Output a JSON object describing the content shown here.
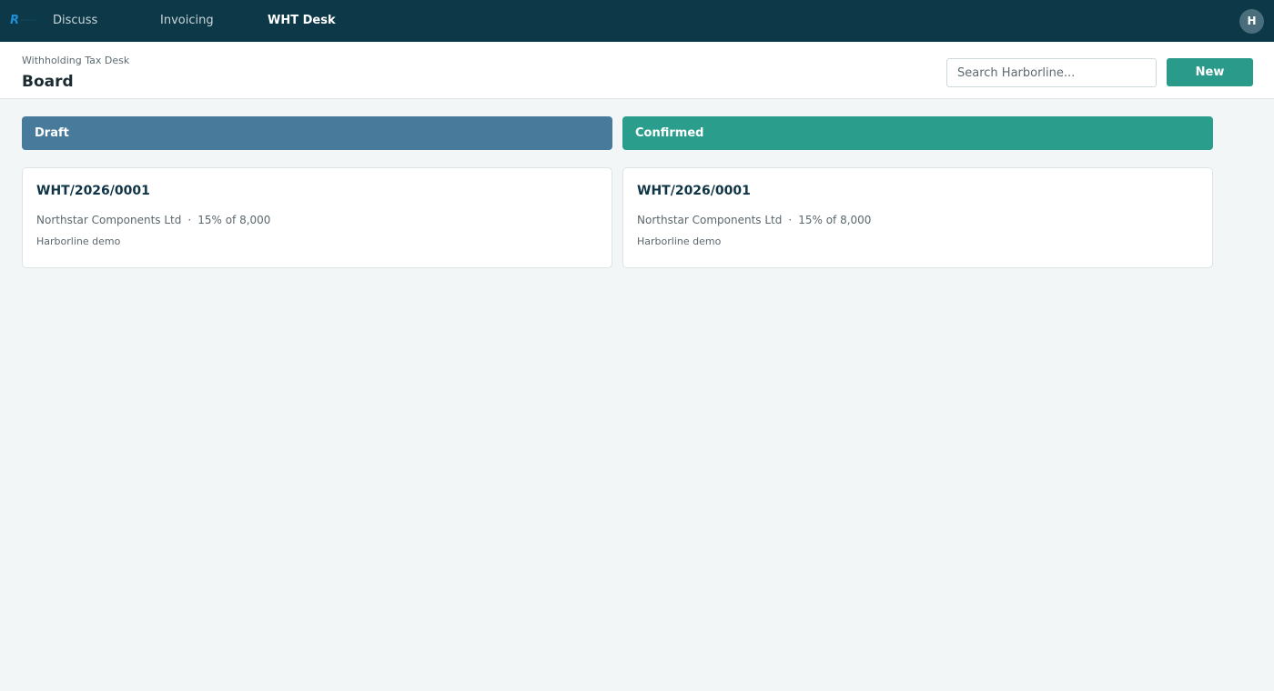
{
  "nav": {
    "items": [
      {
        "label": "Discuss"
      },
      {
        "label": "Invoicing"
      },
      {
        "label": "WHT Desk"
      }
    ],
    "avatar_initial": "H"
  },
  "header": {
    "breadcrumb": "Withholding Tax Desk",
    "title": "Board",
    "search_placeholder": "Search Harborline...",
    "new_label": "New"
  },
  "columns": [
    {
      "name": "Draft",
      "color": "#477a9b",
      "cards": [
        {
          "reference": "WHT/2026/0001",
          "partner": "Northstar Components Ltd",
          "separator": "·",
          "rate": "15% of 8,000",
          "company": "Harborline demo"
        }
      ]
    },
    {
      "name": "Confirmed",
      "color": "#2b9d8c",
      "cards": [
        {
          "reference": "WHT/2026/0001",
          "partner": "Northstar Components Ltd",
          "separator": "·",
          "rate": "15% of 8,000",
          "company": "Harborline demo"
        }
      ]
    }
  ],
  "colors": {
    "topbar": "#0d3847",
    "accent": "#2a9a8a",
    "background": "#f2f6f6"
  }
}
